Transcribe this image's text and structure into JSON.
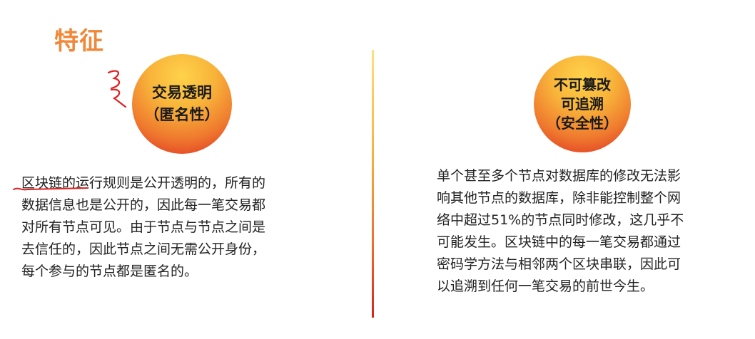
{
  "title": "特征",
  "left": {
    "circle_line1": "交易透明",
    "circle_line2": "（匿名性）",
    "paragraph_lines": [
      "区块链的运行规则是公开透明的，所有的",
      "数据信息也是公开的，因此每一笔交易都",
      "对所有节点可见。由于节点与节点之间是",
      "去信任的，因此节点之间无需公开身份，",
      "每个参与的节点都是匿名的。"
    ]
  },
  "right": {
    "circle_line1": "不可篡改",
    "circle_line2": "可追溯",
    "circle_line3": "（安全性）",
    "paragraph_lines": [
      "单个甚至多个节点对数据库的修改无法影",
      "响其他节点的数据库，除非能控制整个网",
      "络中超过51%的节点同时修改，这几乎不",
      "可能发生。区块链中的每一笔交易都通过",
      "密码学方法与相邻两个区块串联，因此可",
      "以追溯到任何一笔交易的前世今生。"
    ]
  },
  "colors": {
    "title": "#f0883a",
    "annotation": "#e02020",
    "divider_top": "#ffe07a",
    "divider_bottom": "#d7231e"
  }
}
